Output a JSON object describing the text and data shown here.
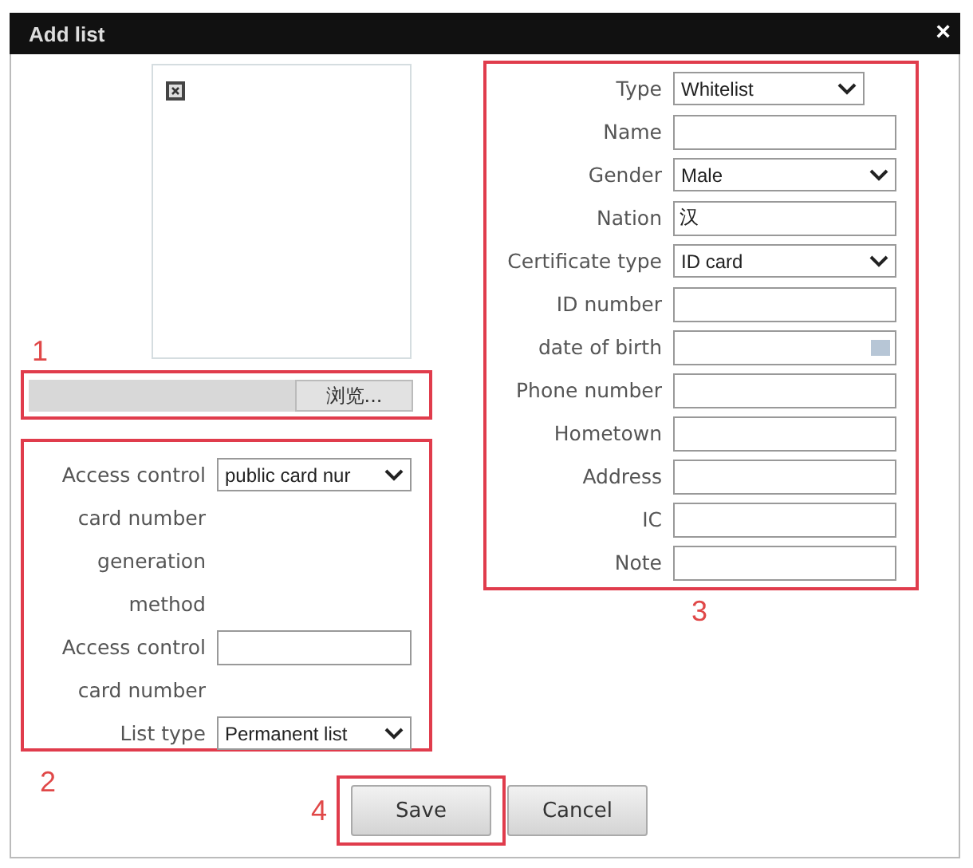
{
  "window": {
    "title": "Add list",
    "close": "×"
  },
  "photo": {
    "marker": "1",
    "upload_button": "浏览..."
  },
  "access_section": {
    "marker": "2",
    "rows": [
      {
        "label": "Access control",
        "kind": "select",
        "value": "public card nur"
      },
      {
        "label": "card number",
        "kind": "text"
      },
      {
        "label": "generation",
        "kind": "text"
      },
      {
        "label": "method",
        "kind": "text"
      },
      {
        "label": "Access control",
        "kind": "input",
        "value": ""
      },
      {
        "label": "card number",
        "kind": "text"
      },
      {
        "label": "List type",
        "kind": "select",
        "value": "Permanent list"
      }
    ]
  },
  "person_section": {
    "marker": "3",
    "rows": [
      {
        "label": "Type",
        "kind": "select",
        "value": "Whitelist"
      },
      {
        "label": "Name",
        "kind": "input",
        "value": ""
      },
      {
        "label": "Gender",
        "kind": "select",
        "value": "Male"
      },
      {
        "label": "Nation",
        "kind": "input",
        "value": "汉"
      },
      {
        "label": "Certificate type",
        "kind": "select",
        "value": "ID card"
      },
      {
        "label": "ID number",
        "kind": "input",
        "value": ""
      },
      {
        "label": "date of birth",
        "kind": "date",
        "value": ""
      },
      {
        "label": "Phone number",
        "kind": "input",
        "value": ""
      },
      {
        "label": "Hometown",
        "kind": "input",
        "value": ""
      },
      {
        "label": "Address",
        "kind": "input",
        "value": ""
      },
      {
        "label": "IC",
        "kind": "input",
        "value": ""
      },
      {
        "label": "Note",
        "kind": "input",
        "value": ""
      }
    ]
  },
  "footer": {
    "marker": "4",
    "buttons": [
      {
        "label": "Save",
        "highlighted": true
      },
      {
        "label": "Cancel",
        "highlighted": false
      }
    ]
  }
}
